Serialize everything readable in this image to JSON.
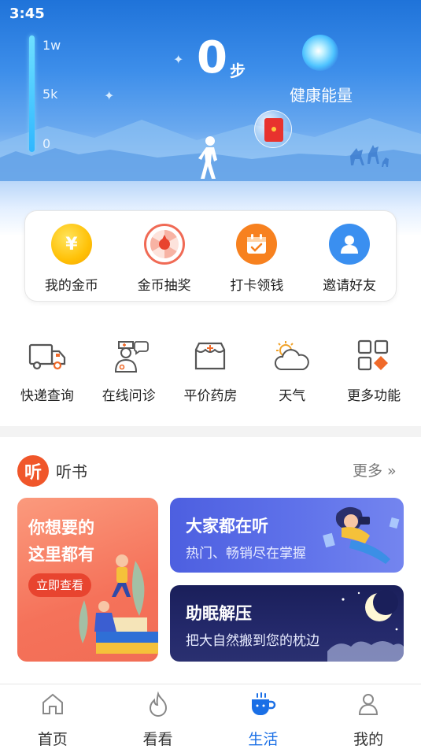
{
  "status_bar": {
    "time": "3:45"
  },
  "hero": {
    "scale_labels": [
      "1w",
      "5k",
      "0"
    ],
    "steps_value": "0",
    "steps_unit": "步",
    "energy_label": "健康能量"
  },
  "coin_actions": [
    {
      "label": "我的金币",
      "icon": "gold-coin-icon"
    },
    {
      "label": "金币抽奖",
      "icon": "lottery-wheel-icon"
    },
    {
      "label": "打卡领钱",
      "icon": "calendar-check-icon"
    },
    {
      "label": "邀请好友",
      "icon": "invite-friend-icon"
    }
  ],
  "services": [
    {
      "label": "快递查询",
      "icon": "delivery-truck-icon"
    },
    {
      "label": "在线问诊",
      "icon": "doctor-consult-icon"
    },
    {
      "label": "平价药房",
      "icon": "pharmacy-icon"
    },
    {
      "label": "天气",
      "icon": "weather-icon"
    },
    {
      "label": "更多功能",
      "icon": "more-grid-icon"
    }
  ],
  "listen": {
    "logo_text": "听",
    "title": "听书",
    "more": "更多 »",
    "left_card": {
      "line1": "你想要的",
      "line2": "这里都有",
      "button": "立即查看"
    },
    "card_popular": {
      "title": "大家都在听",
      "subtitle": "热门、畅销尽在掌握"
    },
    "card_sleep": {
      "title": "助眠解压",
      "subtitle": "把大自然搬到您的枕边"
    }
  },
  "bottom_nav": [
    {
      "label": "首页",
      "icon": "home-icon",
      "active": false
    },
    {
      "label": "看看",
      "icon": "flame-icon",
      "active": false
    },
    {
      "label": "生活",
      "icon": "coffee-cup-icon",
      "active": true
    },
    {
      "label": "我的",
      "icon": "user-icon",
      "active": false
    }
  ],
  "colors": {
    "accent": "#1a6fe6",
    "listen_orange": "#f0562a",
    "coin_gold": "#ffc107"
  }
}
